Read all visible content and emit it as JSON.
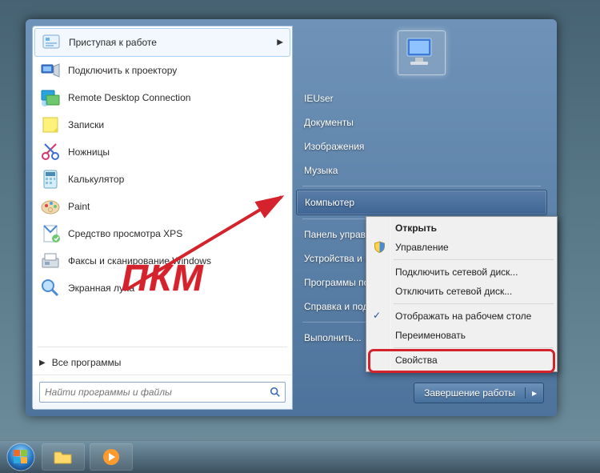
{
  "programs": [
    {
      "label": "Приступая к работе",
      "icon": "getting-started",
      "has_submenu": true
    },
    {
      "label": "Подключить к проектору",
      "icon": "projector"
    },
    {
      "label": "Remote Desktop Connection",
      "icon": "rdc"
    },
    {
      "label": "Записки",
      "icon": "sticky-notes"
    },
    {
      "label": "Ножницы",
      "icon": "snipping"
    },
    {
      "label": "Калькулятор",
      "icon": "calc"
    },
    {
      "label": "Paint",
      "icon": "paint"
    },
    {
      "label": "Средство просмотра XPS",
      "icon": "xps"
    },
    {
      "label": "Факсы и сканирование Windows",
      "icon": "fax"
    },
    {
      "label": "Экранная лупа",
      "icon": "magnifier"
    }
  ],
  "all_programs_label": "Все программы",
  "search_placeholder": "Найти программы и файлы",
  "right_items": [
    {
      "label": "IEUser",
      "type": "user"
    },
    {
      "label": "Документы"
    },
    {
      "label": "Изображения"
    },
    {
      "label": "Музыка"
    },
    {
      "sep": true
    },
    {
      "label": "Компьютер",
      "highlight": true
    },
    {
      "sep": true
    },
    {
      "label": "Панель управления"
    },
    {
      "label": "Устройства и принтеры"
    },
    {
      "label": "Программы по умолчанию"
    },
    {
      "label": "Справка и поддержка"
    },
    {
      "sep": true
    },
    {
      "label": "Выполнить..."
    }
  ],
  "shutdown_label": "Завершение работы",
  "context_menu": [
    {
      "label": "Открыть",
      "bold": true
    },
    {
      "label": "Управление",
      "icon": "shield"
    },
    {
      "sep": true
    },
    {
      "label": "Подключить сетевой диск..."
    },
    {
      "label": "Отключить сетевой диск..."
    },
    {
      "sep": true
    },
    {
      "label": "Отображать на рабочем столе",
      "check": true
    },
    {
      "label": "Переименовать"
    },
    {
      "sep": true
    },
    {
      "label": "Свойства",
      "callout": true
    }
  ],
  "annotation": {
    "text": "ПКМ",
    "color": "#d4232c"
  }
}
